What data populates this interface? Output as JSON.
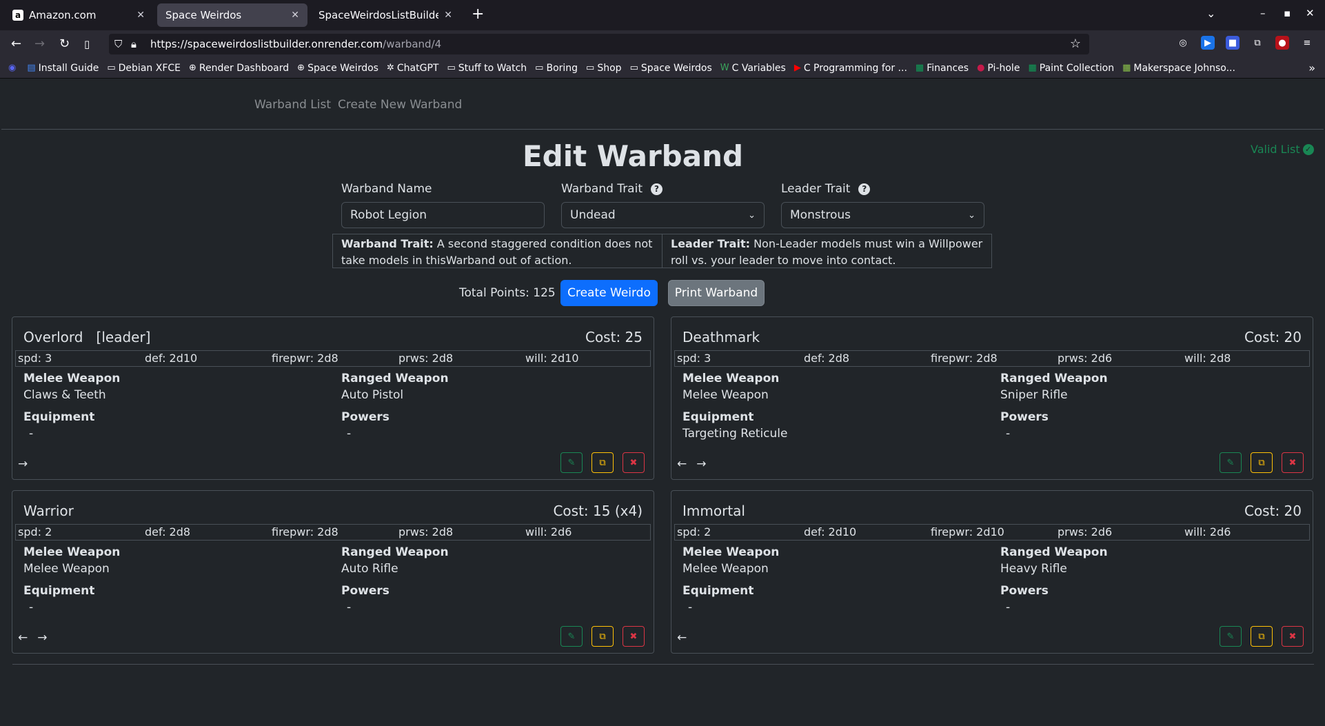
{
  "browser": {
    "tabs": [
      {
        "title": "Amazon.com",
        "favicon": "a"
      },
      {
        "title": "Space Weirdos",
        "favicon": ""
      },
      {
        "title": "SpaceWeirdosListBuilder ·",
        "favicon": ""
      }
    ],
    "url_host": "https://spaceweirdoslistbuilder.onrender.com",
    "url_path": "/warband/4",
    "bookmarks": [
      {
        "label": "Install Guide",
        "icon": "doc-icon"
      },
      {
        "label": "Debian XFCE",
        "icon": "folder-icon"
      },
      {
        "label": "Render Dashboard",
        "icon": "globe-icon"
      },
      {
        "label": "Space Weirdos",
        "icon": "globe-icon"
      },
      {
        "label": "ChatGPT",
        "icon": "chatgpt-icon"
      },
      {
        "label": "Stuff to Watch",
        "icon": "folder-icon"
      },
      {
        "label": "Boring",
        "icon": "folder-icon"
      },
      {
        "label": "Shop",
        "icon": "folder-icon"
      },
      {
        "label": "Space Weirdos",
        "icon": "folder-icon"
      },
      {
        "label": "C Variables",
        "icon": "w-icon"
      },
      {
        "label": "C Programming for ...",
        "icon": "youtube-icon"
      },
      {
        "label": "Finances",
        "icon": "sheets-icon"
      },
      {
        "label": "Pi-hole",
        "icon": "raspberry-icon"
      },
      {
        "label": "Paint Collection",
        "icon": "sheets-icon"
      },
      {
        "label": "Makerspace Johnso...",
        "icon": "calendar-icon"
      }
    ]
  },
  "nav": {
    "warband_list": "Warband List",
    "create_new": "Create New Warband"
  },
  "status": {
    "valid_text": "Valid List",
    "color": "#198754"
  },
  "page_title": "Edit Warband",
  "form": {
    "name_label": "Warband Name",
    "name_value": "Robot Legion",
    "warband_trait_label": "Warband Trait",
    "warband_trait_value": "Undead",
    "leader_trait_label": "Leader Trait",
    "leader_trait_value": "Monstrous"
  },
  "traits": {
    "warband_label": "Warband Trait:",
    "warband_text": " A second staggered condition does not take models in thisWarband out of action.",
    "leader_label": "Leader Trait:",
    "leader_text": " Non-Leader models must win a Willpower roll vs. your leader to move into contact."
  },
  "summary": {
    "total_points": "Total Points: 125",
    "create_weirdo": "Create Weirdo",
    "print_warband": "Print Warband"
  },
  "labels": {
    "melee": "Melee Weapon",
    "ranged": "Ranged Weapon",
    "equipment": "Equipment",
    "powers": "Powers"
  },
  "weirdos": [
    {
      "name": "Overlord   [leader]",
      "cost": "Cost: 25",
      "spd": "spd: 3",
      "def": "def: 2d10",
      "firepwr": "firepwr: 2d8",
      "prws": "prws: 2d8",
      "will": "will: 2d10",
      "melee": "Claws & Teeth",
      "ranged": "Auto Pistol",
      "equipment": "-",
      "powers": "-",
      "arrows": [
        "→"
      ]
    },
    {
      "name": "Deathmark",
      "cost": "Cost: 20",
      "spd": "spd: 3",
      "def": "def: 2d8",
      "firepwr": "firepwr: 2d8",
      "prws": "prws: 2d6",
      "will": "will: 2d8",
      "melee": "Melee Weapon",
      "ranged": "Sniper Rifle",
      "equipment": "Targeting Reticule",
      "powers": "-",
      "arrows": [
        "←",
        "→"
      ]
    },
    {
      "name": "Warrior",
      "cost": "Cost: 15 (x4)",
      "spd": "spd: 2",
      "def": "def: 2d8",
      "firepwr": "firepwr: 2d8",
      "prws": "prws: 2d8",
      "will": "will: 2d6",
      "melee": "Melee Weapon",
      "ranged": "Auto Rifle",
      "equipment": "-",
      "powers": "-",
      "arrows": [
        "←",
        "→"
      ]
    },
    {
      "name": "Immortal",
      "cost": "Cost: 20",
      "spd": "spd: 2",
      "def": "def: 2d10",
      "firepwr": "firepwr: 2d10",
      "prws": "prws: 2d6",
      "will": "will: 2d6",
      "melee": "Melee Weapon",
      "ranged": "Heavy Rifle",
      "equipment": "-",
      "powers": "-",
      "arrows": [
        "←"
      ]
    }
  ]
}
